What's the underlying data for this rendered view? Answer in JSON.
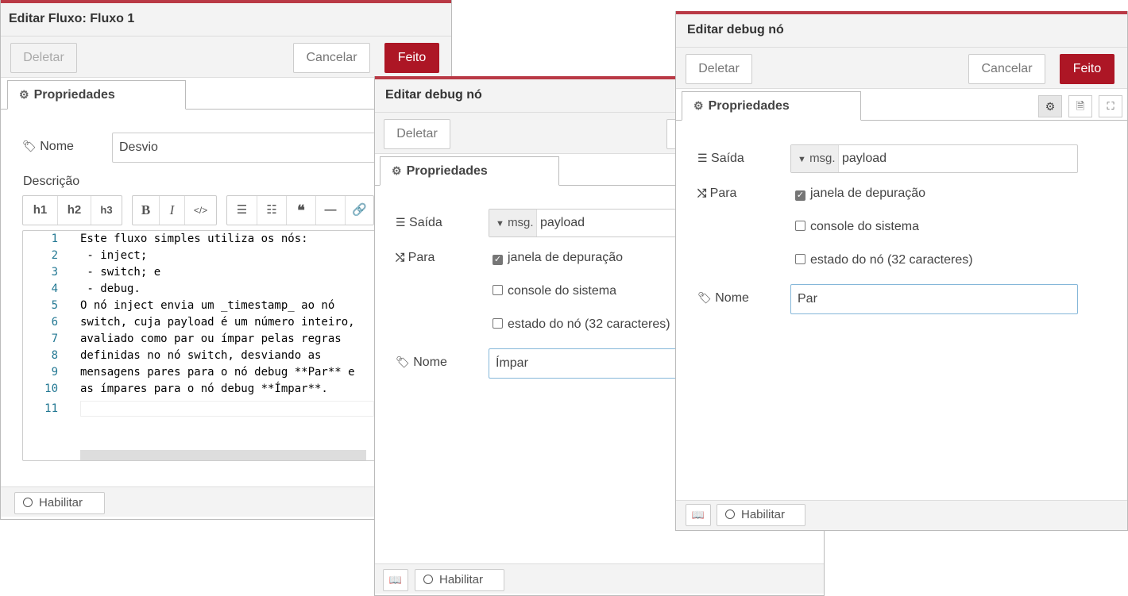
{
  "flow_tray": {
    "title": "Editar Fluxo: Fluxo 1",
    "delete": "Deletar",
    "cancel": "Cancelar",
    "done": "Feito",
    "tab": "Propriedades",
    "name_label": "Nome",
    "name_value": "Desvio",
    "description_label": "Descrição",
    "md_buttons": [
      "h1",
      "h2",
      "h3",
      "B",
      "I",
      "</>",
      "ol",
      "ul",
      "❝",
      "—",
      "link"
    ],
    "code_lines": [
      {
        "n": "1",
        "text": "Este fluxo simples utiliza os nós:"
      },
      {
        "n": "2",
        "text": " - inject;"
      },
      {
        "n": "3",
        "text": " - switch; e"
      },
      {
        "n": "4",
        "text": " - debug."
      },
      {
        "n": "5",
        "text": "O nó inject envia um _timestamp_ ao nó"
      },
      {
        "n": "6",
        "text": "switch, cuja payload é um número inteiro,"
      },
      {
        "n": "7",
        "text": "avaliado como par ou ímpar pelas regras"
      },
      {
        "n": "8",
        "text": "definidas no nó switch, desviando as"
      },
      {
        "n": "9",
        "text": "mensagens pares para o nó debug **Par** e"
      },
      {
        "n": "10",
        "text": "as ímpares para o nó debug **Ímpar**."
      },
      {
        "n": "11",
        "text": ""
      }
    ],
    "enable": "Habilitar"
  },
  "debug_tray_impar": {
    "title": "Editar debug nó",
    "delete": "Deletar",
    "tab": "Propriedades",
    "output_label": "Saída",
    "output_prefix": "msg.",
    "output_value": "payload",
    "to_label": "Para",
    "opt_debug": "janela de depuração",
    "opt_console": "console do sistema",
    "opt_status": "estado do nó (32 caracteres)",
    "name_label": "Nome",
    "name_value": "Ímpar",
    "enable": "Habilitar"
  },
  "debug_tray_par": {
    "title": "Editar debug nó",
    "delete": "Deletar",
    "cancel": "Cancelar",
    "done": "Feito",
    "tab": "Propriedades",
    "output_label": "Saída",
    "output_prefix": "msg.",
    "output_value": "payload",
    "to_label": "Para",
    "opt_debug": "janela de depuração",
    "opt_console": "console do sistema",
    "opt_status": "estado do nó (32 caracteres)",
    "name_label": "Nome",
    "name_value": "Par",
    "enable": "Habilitar"
  },
  "colors": {
    "accent": "#ad1625",
    "panel": "#f3f3f3"
  }
}
